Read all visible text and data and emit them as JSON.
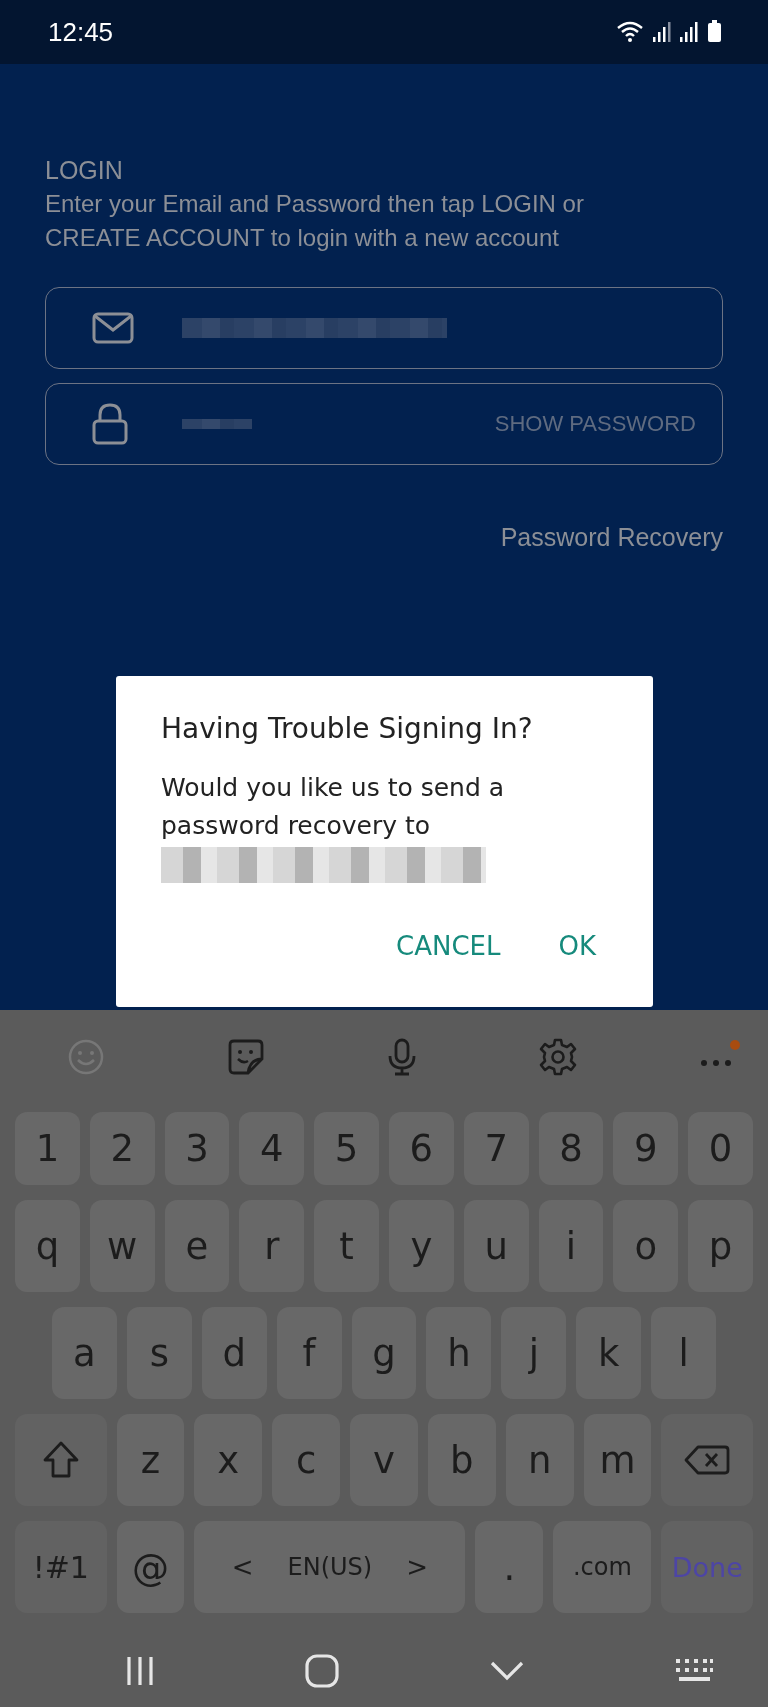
{
  "status_bar": {
    "time": "12:45"
  },
  "login": {
    "heading": "LOGIN",
    "description": "Enter your Email and Password then tap LOGIN or CREATE ACCOUNT to login with a new account",
    "show_password": "SHOW PASSWORD",
    "recovery_link": "Password Recovery"
  },
  "dialog": {
    "title": "Having Trouble Signing In?",
    "message": "Would you like us to send a password recovery to",
    "buttons": [
      "CANCEL",
      "OK"
    ]
  },
  "keyboard": {
    "rows": [
      {
        "keys": [
          {
            "kind": "char",
            "label": "1"
          },
          {
            "kind": "char",
            "label": "2"
          },
          {
            "kind": "char",
            "label": "3"
          },
          {
            "kind": "char",
            "label": "4"
          },
          {
            "kind": "char",
            "label": "5"
          },
          {
            "kind": "char",
            "label": "6"
          },
          {
            "kind": "char",
            "label": "7"
          },
          {
            "kind": "char",
            "label": "8"
          },
          {
            "kind": "char",
            "label": "9"
          },
          {
            "kind": "char",
            "label": "0"
          }
        ]
      },
      {
        "keys": [
          {
            "kind": "char",
            "label": "q"
          },
          {
            "kind": "char",
            "label": "w"
          },
          {
            "kind": "char",
            "label": "e"
          },
          {
            "kind": "char",
            "label": "r"
          },
          {
            "kind": "char",
            "label": "t"
          },
          {
            "kind": "char",
            "label": "y"
          },
          {
            "kind": "char",
            "label": "u"
          },
          {
            "kind": "char",
            "label": "i"
          },
          {
            "kind": "char",
            "label": "o"
          },
          {
            "kind": "char",
            "label": "p"
          }
        ]
      },
      {
        "keys": [
          {
            "kind": "char",
            "label": "a"
          },
          {
            "kind": "char",
            "label": "s"
          },
          {
            "kind": "char",
            "label": "d"
          },
          {
            "kind": "char",
            "label": "f"
          },
          {
            "kind": "char",
            "label": "g"
          },
          {
            "kind": "char",
            "label": "h"
          },
          {
            "kind": "char",
            "label": "j"
          },
          {
            "kind": "char",
            "label": "k"
          },
          {
            "kind": "char",
            "label": "l"
          }
        ]
      },
      {
        "keys": [
          {
            "kind": "shift"
          },
          {
            "kind": "char",
            "label": "z"
          },
          {
            "kind": "char",
            "label": "x"
          },
          {
            "kind": "char",
            "label": "c"
          },
          {
            "kind": "char",
            "label": "v"
          },
          {
            "kind": "char",
            "label": "b"
          },
          {
            "kind": "char",
            "label": "n"
          },
          {
            "kind": "char",
            "label": "m"
          },
          {
            "kind": "backspace"
          }
        ]
      },
      {
        "keys": [
          {
            "kind": "symbols",
            "label": "!#1"
          },
          {
            "kind": "char",
            "label": "@"
          },
          {
            "kind": "space",
            "label": "EN(US)",
            "left": "<",
            "right": ">"
          },
          {
            "kind": "char",
            "label": "."
          },
          {
            "kind": "wide",
            "label": ".com"
          },
          {
            "kind": "done",
            "label": "Done"
          }
        ]
      }
    ]
  }
}
